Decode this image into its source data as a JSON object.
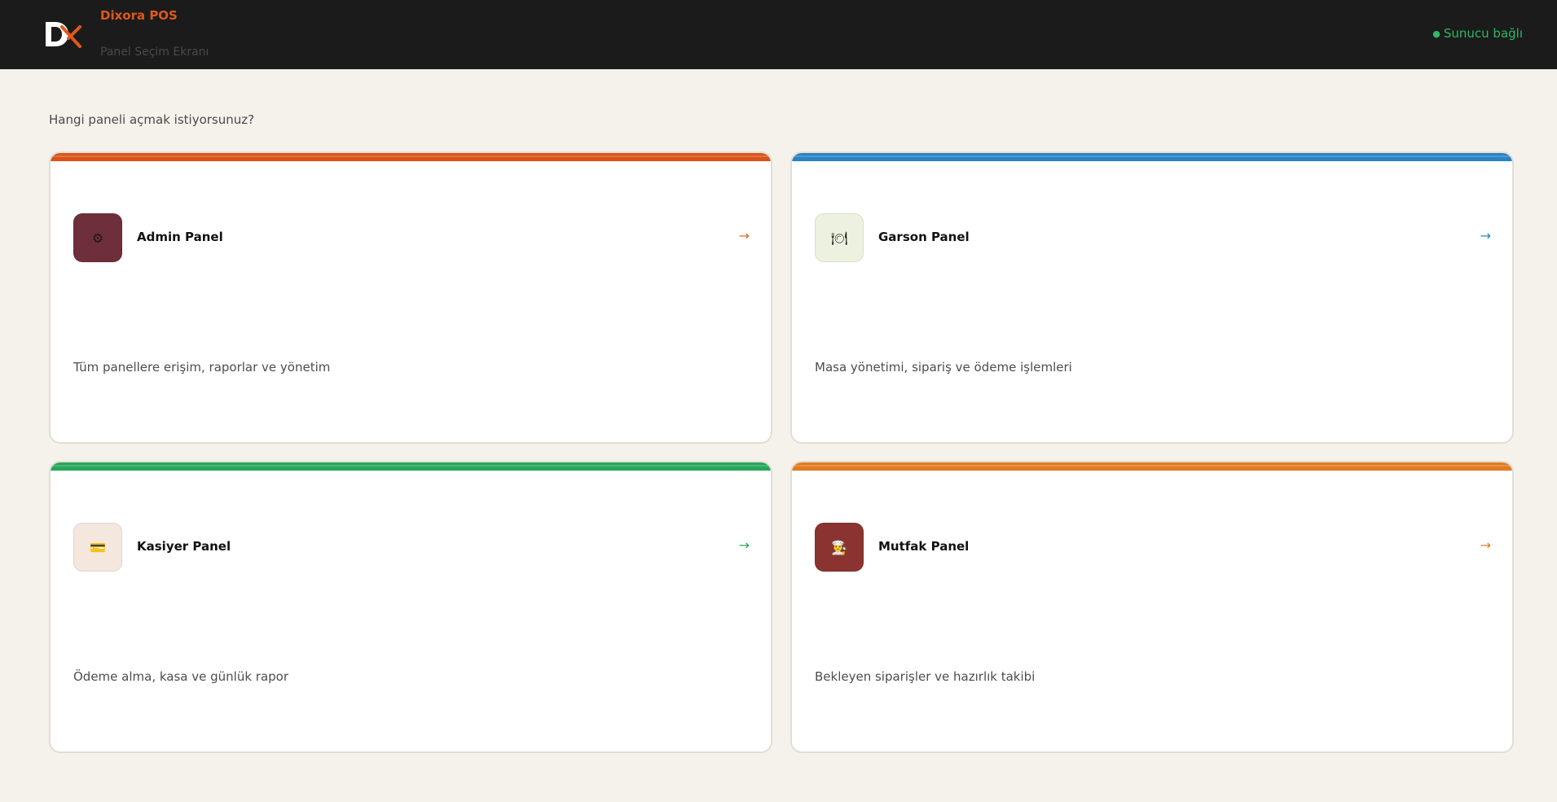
{
  "header": {
    "brand_title": "Dixora POS",
    "brand_subtitle": "Panel Seçim Ekranı",
    "status_dot": "●",
    "status_text": "Sunucu bağlı",
    "logo_icon": "dx-logo-icon"
  },
  "main": {
    "prompt": "Hangi paneli açmak istiyorsunuz?"
  },
  "panels": [
    {
      "title": "Admin Panel",
      "description": "Tüm panellere erişim, raporlar ve yönetim",
      "icon": "gear-icon",
      "icon_glyph": "⚙",
      "arrow": "→",
      "accent_color": "#d9541a",
      "icon_bg": "#6e2e3c",
      "arrow_color": "#e06a1e"
    },
    {
      "title": "Garson Panel",
      "description": "Masa yönetimi, sipariş ve ödeme işlemleri",
      "icon": "plate-icon",
      "icon_glyph": "🍽",
      "arrow": "→",
      "accent_color": "#2b82c2",
      "icon_bg": "#ecf2df",
      "arrow_color": "#2b82c2"
    },
    {
      "title": "Kasiyer Panel",
      "description": "Ödeme alma, kasa ve günlük rapor",
      "icon": "credit-card-icon",
      "icon_glyph": "💳",
      "arrow": "→",
      "accent_color": "#27a75a",
      "icon_bg": "#f3e7de",
      "arrow_color": "#27a75a"
    },
    {
      "title": "Mutfak Panel",
      "description": "Bekleyen siparişler ve hazırlık takibi",
      "icon": "chef-icon",
      "icon_glyph": "👨‍🍳",
      "arrow": "→",
      "accent_color": "#e07b22",
      "icon_bg": "#8b3330",
      "arrow_color": "#e07b22"
    }
  ]
}
